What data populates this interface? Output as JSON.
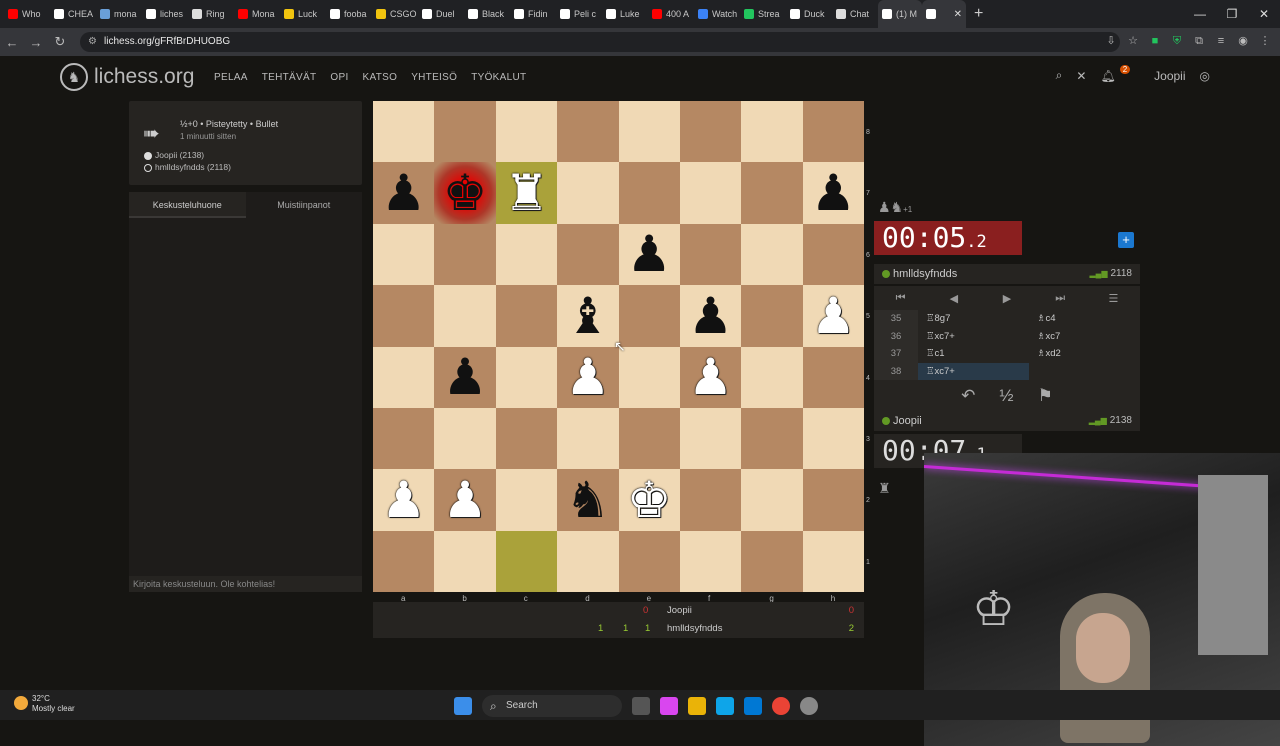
{
  "browser": {
    "tabs": [
      {
        "label": "Who",
        "color": "#ff0000"
      },
      {
        "label": "CHEA",
        "color": "#ffffff"
      },
      {
        "label": "mona",
        "color": "#6a9fd8"
      },
      {
        "label": "liches",
        "color": "#ffffff"
      },
      {
        "label": "Ring",
        "color": "#dddddd"
      },
      {
        "label": "Mona",
        "color": "#ff0000"
      },
      {
        "label": "Luck",
        "color": "#f1c40f"
      },
      {
        "label": "fooba",
        "color": "#ffffff"
      },
      {
        "label": "CSGO",
        "color": "#f1c40f"
      },
      {
        "label": "Duel",
        "color": "#ffffff"
      },
      {
        "label": "Black",
        "color": "#ffffff"
      },
      {
        "label": "Fidin",
        "color": "#ffffff"
      },
      {
        "label": "Peli c",
        "color": "#ffffff"
      },
      {
        "label": "Luke",
        "color": "#ffffff"
      },
      {
        "label": "400 A",
        "color": "#ff0000"
      },
      {
        "label": "Watch",
        "color": "#3b82f6"
      },
      {
        "label": "Strea",
        "color": "#22c55e"
      },
      {
        "label": "Duck",
        "color": "#ffffff"
      },
      {
        "label": "Chat",
        "color": "#dddddd"
      },
      {
        "label": "(1) M",
        "color": "#ffffff"
      }
    ],
    "url": "lichess.org/gFRfBrDHUOBG"
  },
  "header": {
    "logo_text": "lichess.org",
    "nav": [
      "PELAA",
      "TEHTÄVÄT",
      "OPI",
      "KATSO",
      "YHTEISÖ",
      "TYÖKALUT"
    ],
    "notifications": "2",
    "user": "Joopii"
  },
  "game_info": {
    "title": "½+0 • Pisteytetty • Bullet",
    "time_ago": "1 minuutti sitten",
    "white_player": "Joopii (2138)",
    "black_player": "hmlldsyfndds (2118)"
  },
  "chat": {
    "tab_chat": "Keskusteluhuone",
    "tab_notes": "Muistiinpanot",
    "placeholder": "Kirjoita keskusteluun. Ole kohtelias!"
  },
  "board": {
    "orientation": "white",
    "last_move": [
      "c7",
      "c1"
    ],
    "check_square": "b7",
    "pieces": {
      "a7": "bp",
      "b7": "bk",
      "c7": "wr",
      "h7": "bp",
      "e6": "bp",
      "d5": "bb",
      "f5": "bp",
      "h5": "wp",
      "b4": "bp",
      "d4": "wp",
      "f4": "wp",
      "a2": "wp",
      "b2": "wp",
      "d2": "bn",
      "e2": "wk"
    },
    "files": [
      "a",
      "b",
      "c",
      "d",
      "e",
      "f",
      "g",
      "h"
    ],
    "ranks": [
      "8",
      "7",
      "6",
      "5",
      "4",
      "3",
      "2",
      "1"
    ]
  },
  "opponent": {
    "name": "hmlldsyfndds",
    "rating": "2118",
    "clock_main": "00:05",
    "clock_tenths": ".2",
    "captured": "♟♞",
    "captured_diff": "+1"
  },
  "player": {
    "name": "Joopii",
    "rating": "2138",
    "clock_main": "00:07",
    "clock_tenths": ".1"
  },
  "moves": [
    {
      "num": "35",
      "white": "♖8g7",
      "black": "♗c4"
    },
    {
      "num": "36",
      "white": "♖xc7+",
      "black": "♗xc7"
    },
    {
      "num": "37",
      "white": "♖c1",
      "black": "♗xd2"
    },
    {
      "num": "38",
      "white": "♖xc7+",
      "black": ""
    }
  ],
  "controls": [
    "⏮",
    "◀",
    "▶",
    "⏭",
    "☰"
  ],
  "actions": [
    "↶",
    "½",
    "⚑"
  ],
  "score": {
    "row1": {
      "a": "",
      "b": "0",
      "name": "Joopii",
      "score": "0"
    },
    "row2": {
      "a": "1",
      "b": "1",
      "c": "1",
      "name": "hmlldsyfndds",
      "score": "2"
    }
  },
  "taskbar": {
    "temp": "32°C",
    "weather": "Mostly clear",
    "search": "Search"
  }
}
